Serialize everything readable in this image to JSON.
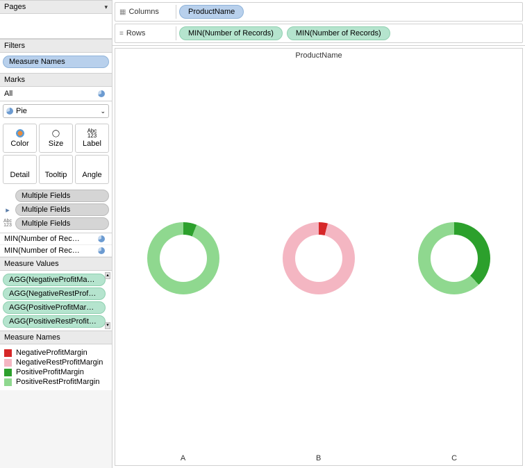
{
  "sidebar": {
    "pages_label": "Pages",
    "filters_label": "Filters",
    "filters_pill": "Measure Names",
    "marks_label": "Marks",
    "marks_all": "All",
    "mark_type": "Pie",
    "mark_props": {
      "color": "Color",
      "size": "Size",
      "label": "Label",
      "detail": "Detail",
      "tooltip": "Tooltip",
      "angle": "Angle"
    },
    "assigned": [
      {
        "sym": "color",
        "label": "Multiple Fields"
      },
      {
        "sym": "detail",
        "label": "Multiple Fields"
      },
      {
        "sym": "label",
        "label": "Multiple Fields"
      }
    ],
    "measure_shelf": [
      "MIN(Number of Rec…",
      "MIN(Number of Rec…"
    ],
    "measure_values_label": "Measure Values",
    "measure_values": [
      "AGG(NegativeProfitMa…",
      "AGG(NegativeRestProf…",
      "AGG(PositiveProfitMar…",
      "AGG(PositiveRestProfit…"
    ],
    "measure_names_label": "Measure Names",
    "legend": [
      {
        "color": "#d62728",
        "label": "NegativeProfitMargin"
      },
      {
        "color": "#f4b6c2",
        "label": "NegativeRestProfitMargin"
      },
      {
        "color": "#2ca02c",
        "label": "PositiveProfitMargin"
      },
      {
        "color": "#8fd88f",
        "label": "PositiveRestProfitMargin"
      }
    ]
  },
  "shelves": {
    "columns_label": "Columns",
    "columns_pills": [
      "ProductName"
    ],
    "rows_label": "Rows",
    "rows_pills": [
      "MIN(Number of Records)",
      "MIN(Number of Records)"
    ]
  },
  "viz": {
    "title": "ProductName",
    "categories": [
      "A",
      "B",
      "C"
    ]
  },
  "chart_data": {
    "type": "pie",
    "title": "ProductName",
    "facets": [
      "A",
      "B",
      "C"
    ],
    "series_colors": {
      "NegativeProfitMargin": "#d62728",
      "NegativeRestProfitMargin": "#f4b6c2",
      "PositiveProfitMargin": "#2ca02c",
      "PositiveRestProfitMargin": "#8fd88f"
    },
    "data": [
      {
        "product": "A",
        "slices": [
          {
            "name": "PositiveProfitMargin",
            "value": 6
          },
          {
            "name": "PositiveRestProfitMargin",
            "value": 94
          }
        ]
      },
      {
        "product": "B",
        "slices": [
          {
            "name": "NegativeProfitMargin",
            "value": 4
          },
          {
            "name": "NegativeRestProfitMargin",
            "value": 96
          }
        ]
      },
      {
        "product": "C",
        "slices": [
          {
            "name": "PositiveProfitMargin",
            "value": 38
          },
          {
            "name": "PositiveRestProfitMargin",
            "value": 62
          }
        ]
      }
    ]
  }
}
